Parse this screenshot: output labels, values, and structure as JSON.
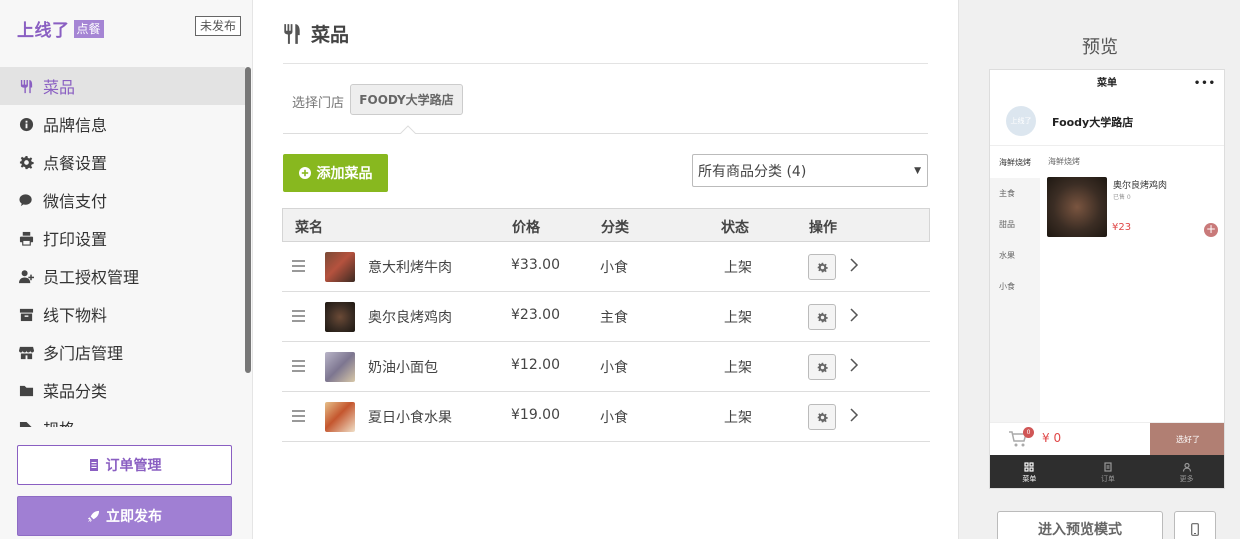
{
  "sidebar": {
    "brand": "上线了",
    "brand_tag": "点餐",
    "status_badge": "未发布",
    "items": [
      {
        "label": "菜品",
        "icon": "cutlery-icon",
        "active": true
      },
      {
        "label": "品牌信息",
        "icon": "info-icon"
      },
      {
        "label": "点餐设置",
        "icon": "gear-icon"
      },
      {
        "label": "微信支付",
        "icon": "wechat-icon"
      },
      {
        "label": "打印设置",
        "icon": "printer-icon"
      },
      {
        "label": "员工授权管理",
        "icon": "user-plus-icon"
      },
      {
        "label": "线下物料",
        "icon": "archive-icon"
      },
      {
        "label": "多门店管理",
        "icon": "store-icon"
      },
      {
        "label": "菜品分类",
        "icon": "folder-icon"
      },
      {
        "label": "规格",
        "icon": "tag-icon"
      }
    ],
    "orders_button": "订单管理",
    "publish_button": "立即发布"
  },
  "main": {
    "title": "菜品",
    "store_label": "选择门店",
    "store_name": "FOODY大学路店",
    "add_button": "添加菜品",
    "category_filter": "所有商品分类 (4)",
    "columns": [
      "菜名",
      "价格",
      "分类",
      "状态",
      "操作"
    ],
    "rows": [
      {
        "name": "意大利烤牛肉",
        "price": "¥33.00",
        "category": "小食",
        "status": "上架",
        "thumb_color": "#5a3a2e"
      },
      {
        "name": "奥尔良烤鸡肉",
        "price": "¥23.00",
        "category": "主食",
        "status": "上架",
        "thumb_color": "#3b2d24"
      },
      {
        "name": "奶油小面包",
        "price": "¥12.00",
        "category": "小食",
        "status": "上架",
        "thumb_color": "#8c8aa6"
      },
      {
        "name": "夏日小食水果",
        "price": "¥19.00",
        "category": "小食",
        "status": "上架",
        "thumb_color": "#c47a48"
      }
    ]
  },
  "preview": {
    "title": "预览",
    "phone": {
      "header": "菜单",
      "more": "•••",
      "avatar": "上线了",
      "store_name": "Foody大学路店",
      "categories": [
        "海鲜烧烤",
        "主食",
        "甜品",
        "水果",
        "小食"
      ],
      "section": "海鲜烧烤",
      "dish": {
        "name": "奥尔良烤鸡肉",
        "sold": "已售 0",
        "price": "¥23"
      },
      "cart_count": "0",
      "cart_total": "¥ 0",
      "checkout": "选好了",
      "tabs": [
        "菜单",
        "订单",
        "更多"
      ]
    },
    "enter_preview": "进入预览模式"
  },
  "colors": {
    "accent": "#8a5fc2",
    "green": "#88b81f",
    "price_red": "#e04848"
  }
}
